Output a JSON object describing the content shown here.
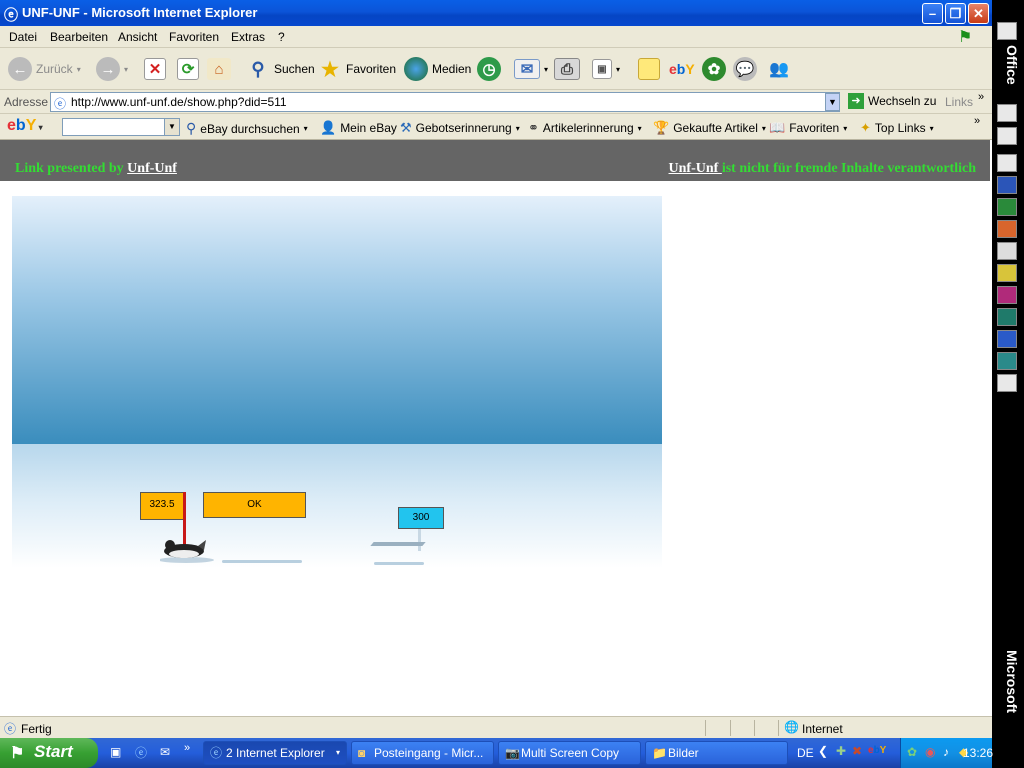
{
  "window": {
    "title": "UNF-UNF - Microsoft Internet Explorer"
  },
  "menu": {
    "items": [
      "Datei",
      "Bearbeiten",
      "Ansicht",
      "Favoriten",
      "Extras",
      "?"
    ]
  },
  "toolbar": {
    "back_label": "Zurück",
    "search_label": "Suchen",
    "favorites_label": "Favoriten",
    "media_label": "Medien"
  },
  "address": {
    "label": "Adresse",
    "url": "http://www.unf-unf.de/show.php?did=511",
    "go_label": "Wechseln zu",
    "links_label": "Links"
  },
  "ebay": {
    "logo": "ebY",
    "search_label": "eBay durchsuchen",
    "my_ebay": "Mein eBay",
    "bid_reminder": "Gebotserinnerung",
    "item_reminder": "Artikelerinnerung",
    "bought_items": "Gekaufte Artikel",
    "favorites": "Favoriten",
    "top_links": "Top Links"
  },
  "page": {
    "left_text": "Link presented by ",
    "left_link": "Unf-Unf",
    "right_link": "Unf-Unf ",
    "right_text": "ist nicht für fremde Inhalte verantwortlich"
  },
  "game": {
    "distance_sign": "323.5",
    "status_sign": "OK",
    "record_sign": "300",
    "distance_color": "#ffb400",
    "record_color": "#22c4ee"
  },
  "statusbar": {
    "status": "Fertig",
    "zone": "Internet"
  },
  "taskbar": {
    "start_label": "Start",
    "tasks": [
      "2 Internet Explorer",
      "Posteingang - Micr...",
      "Multi Screen Copy",
      "Bilder"
    ],
    "language": "DE",
    "clock": "13:26"
  },
  "office": {
    "top": "Office",
    "bottom": "Microsoft"
  }
}
